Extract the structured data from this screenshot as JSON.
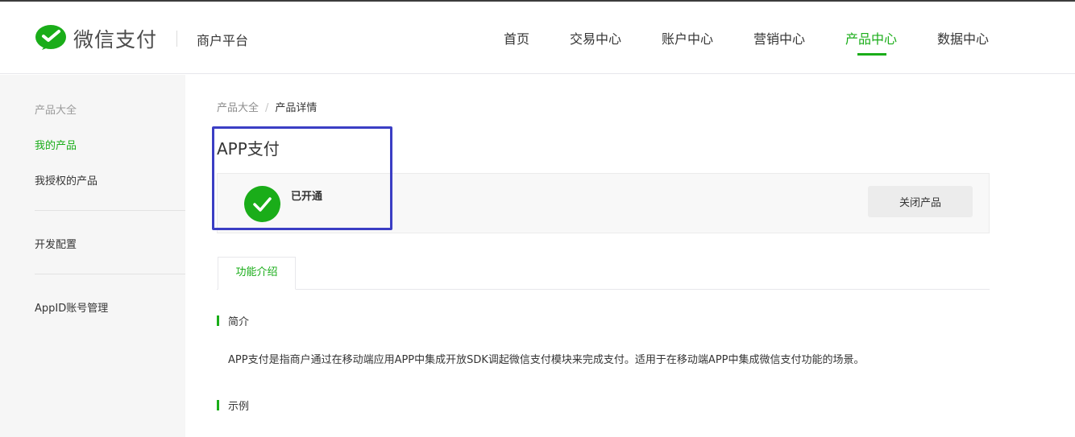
{
  "header": {
    "brand": "微信支付",
    "platform": "商户平台",
    "nav": [
      {
        "label": "首页",
        "active": false
      },
      {
        "label": "交易中心",
        "active": false
      },
      {
        "label": "账户中心",
        "active": false
      },
      {
        "label": "营销中心",
        "active": false
      },
      {
        "label": "产品中心",
        "active": true
      },
      {
        "label": "数据中心",
        "active": false
      }
    ],
    "accent_color": "#1aad19"
  },
  "sidebar": {
    "group_title": "产品大全",
    "items": [
      {
        "label": "我的产品",
        "active": true
      },
      {
        "label": "我授权的产品",
        "active": false
      },
      {
        "label": "开发配置",
        "active": false
      },
      {
        "label": "AppID账号管理",
        "active": false
      }
    ]
  },
  "breadcrumb": {
    "parent": "产品大全",
    "separator": "/",
    "current": "产品详情"
  },
  "product": {
    "title": "APP支付",
    "status": "已开通",
    "status_icon": "check-circle-icon",
    "close_button": "关闭产品",
    "highlight_color": "#3b3ec4"
  },
  "tabs": [
    {
      "label": "功能介绍",
      "active": true
    }
  ],
  "sections": {
    "intro_title": "简介",
    "intro_text": "APP支付是指商户通过在移动端应用APP中集成开放SDK调起微信支付模块来完成支付。适用于在移动端APP中集成微信支付功能的场景。",
    "example_title": "示例"
  }
}
